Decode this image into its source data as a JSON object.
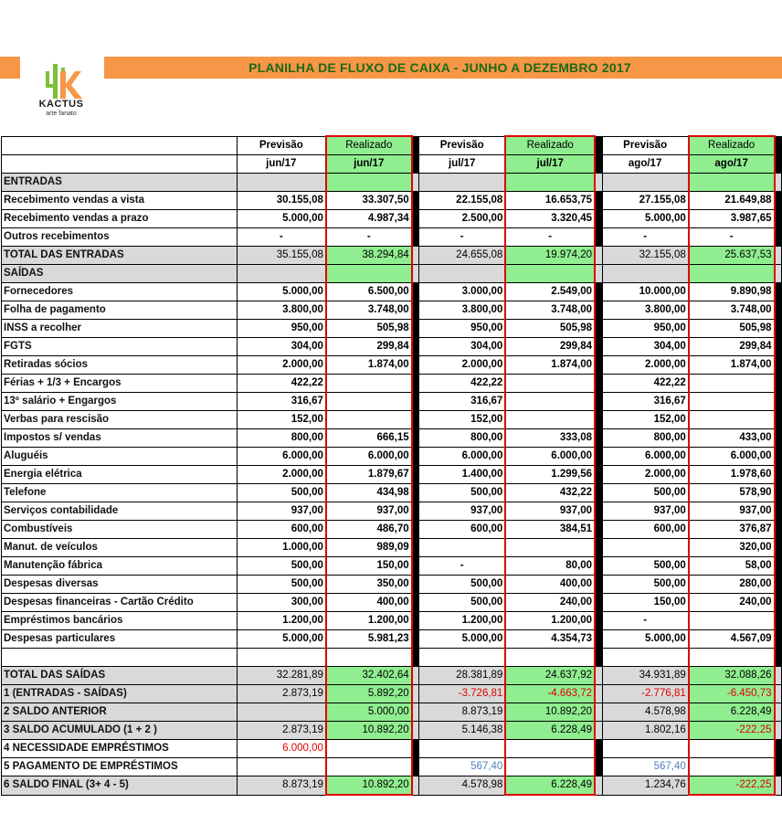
{
  "title": "PLANILHA DE FLUXO DE CAIXA - JUNHO A DEZEMBRO 2017",
  "logo": {
    "name": "KACTUS",
    "sub": "arte fanato"
  },
  "headers": {
    "row1": [
      "Previsão",
      "Realizado",
      "Previsão",
      "Realizado",
      "Previsão",
      "Realizado"
    ],
    "row2": [
      "jun/17",
      "jun/17",
      "jul/17",
      "jul/17",
      "ago/17",
      "ago/17"
    ]
  },
  "rows": [
    {
      "label": "ENTRADAS",
      "type": "section",
      "values": [
        "",
        "",
        "",
        "",
        "",
        ""
      ]
    },
    {
      "label": "Recebimento vendas a vista",
      "values": [
        "30.155,08",
        "33.307,50",
        "22.155,08",
        "16.653,75",
        "27.155,08",
        "21.649,88"
      ]
    },
    {
      "label": "Recebimento vendas a prazo",
      "values": [
        "5.000,00",
        "4.987,34",
        "2.500,00",
        "3.320,45",
        "5.000,00",
        "3.987,65"
      ]
    },
    {
      "label": "Outros recebimentos",
      "values": [
        "-",
        "-",
        "-",
        "-",
        "-",
        "-"
      ]
    },
    {
      "label": "TOTAL DAS ENTRADAS",
      "type": "total",
      "values": [
        "35.155,08",
        "38.294,84",
        "24.655,08",
        "19.974,20",
        "32.155,08",
        "25.637,53"
      ]
    },
    {
      "label": "SAÍDAS",
      "type": "section",
      "values": [
        "",
        "",
        "",
        "",
        "",
        ""
      ]
    },
    {
      "label": "Fornecedores",
      "values": [
        "5.000,00",
        "6.500,00",
        "3.000,00",
        "2.549,00",
        "10.000,00",
        "9.890,98"
      ]
    },
    {
      "label": "Folha de pagamento",
      "values": [
        "3.800,00",
        "3.748,00",
        "3.800,00",
        "3.748,00",
        "3.800,00",
        "3.748,00"
      ]
    },
    {
      "label": "INSS a recolher",
      "values": [
        "950,00",
        "505,98",
        "950,00",
        "505,98",
        "950,00",
        "505,98"
      ]
    },
    {
      "label": "FGTS",
      "values": [
        "304,00",
        "299,84",
        "304,00",
        "299,84",
        "304,00",
        "299,84"
      ]
    },
    {
      "label": "Retiradas sócios",
      "values": [
        "2.000,00",
        "1.874,00",
        "2.000,00",
        "1.874,00",
        "2.000,00",
        "1.874,00"
      ]
    },
    {
      "label": "Férias + 1/3 + Encargos",
      "values": [
        "422,22",
        "",
        "422,22",
        "",
        "422,22",
        ""
      ]
    },
    {
      "label": "13º salário + Engargos",
      "values": [
        "316,67",
        "",
        "316,67",
        "",
        "316,67",
        ""
      ]
    },
    {
      "label": "Verbas para rescisão",
      "values": [
        "152,00",
        "",
        "152,00",
        "",
        "152,00",
        ""
      ]
    },
    {
      "label": "Impostos s/ vendas",
      "values": [
        "800,00",
        "666,15",
        "800,00",
        "333,08",
        "800,00",
        "433,00"
      ]
    },
    {
      "label": "Aluguéis",
      "values": [
        "6.000,00",
        "6.000,00",
        "6.000,00",
        "6.000,00",
        "6.000,00",
        "6.000,00"
      ]
    },
    {
      "label": "Energia elétrica",
      "values": [
        "2.000,00",
        "1.879,67",
        "1.400,00",
        "1.299,56",
        "2.000,00",
        "1.978,60"
      ]
    },
    {
      "label": "Telefone",
      "values": [
        "500,00",
        "434,98",
        "500,00",
        "432,22",
        "500,00",
        "578,90"
      ]
    },
    {
      "label": "Serviços contabilidade",
      "values": [
        "937,00",
        "937,00",
        "937,00",
        "937,00",
        "937,00",
        "937,00"
      ]
    },
    {
      "label": "Combustíveis",
      "values": [
        "600,00",
        "486,70",
        "600,00",
        "384,51",
        "600,00",
        "376,87"
      ]
    },
    {
      "label": "Manut. de veículos",
      "values": [
        "1.000,00",
        "989,09",
        "",
        "",
        "",
        "320,00"
      ]
    },
    {
      "label": "Manutenção fábrica",
      "values": [
        "500,00",
        "150,00",
        "-",
        "80,00",
        "500,00",
        "58,00"
      ]
    },
    {
      "label": "Despesas diversas",
      "values": [
        "500,00",
        "350,00",
        "500,00",
        "400,00",
        "500,00",
        "280,00"
      ]
    },
    {
      "label": "Despesas financeiras - Cartão Crédito",
      "values": [
        "300,00",
        "400,00",
        "500,00",
        "240,00",
        "150,00",
        "240,00"
      ]
    },
    {
      "label": "Empréstimos bancários",
      "values": [
        "1.200,00",
        "1.200,00",
        "1.200,00",
        "1.200,00",
        "-",
        ""
      ]
    },
    {
      "label": "Despesas particulares",
      "values": [
        "5.000,00",
        "5.981,23",
        "5.000,00",
        "4.354,73",
        "5.000,00",
        "4.567,09"
      ]
    },
    {
      "label": "",
      "type": "blank",
      "values": [
        "",
        "",
        "",
        "",
        "",
        ""
      ]
    },
    {
      "label": "TOTAL DAS SAÍDAS",
      "type": "total",
      "values": [
        "32.281,89",
        "32.402,64",
        "28.381,89",
        "24.637,92",
        "34.931,89",
        "32.088,26"
      ]
    },
    {
      "label": "1 (ENTRADAS - SAÍDAS)",
      "type": "total",
      "values": [
        "2.873,19",
        "5.892,20",
        "-3.726,81",
        "-4.663,72",
        "-2.776,81",
        "-6.450,73"
      ]
    },
    {
      "label": "2 SALDO ANTERIOR",
      "type": "total",
      "values": [
        "",
        "5.000,00",
        "8.873,19",
        "10.892,20",
        "4.578,98",
        "6.228,49"
      ]
    },
    {
      "label": "3 SALDO ACUMULADO (1 + 2 )",
      "type": "total",
      "values": [
        "2.873,19",
        "10.892,20",
        "5.146,38",
        "6.228,49",
        "1.802,16",
        "-222,25"
      ]
    },
    {
      "label": "4 NECESSIDADE EMPRÉSTIMOS",
      "type": "red",
      "values": [
        "6.000,00",
        "",
        "",
        "",
        "",
        ""
      ]
    },
    {
      "label": "5 PAGAMENTO DE EMPRÉSTIMOS",
      "type": "blue",
      "values": [
        "",
        "",
        "567,40",
        "",
        "567,40",
        ""
      ]
    },
    {
      "label": "6 SALDO FINAL (3+ 4 - 5)",
      "type": "total",
      "values": [
        "8.873,19",
        "10.892,20",
        "4.578,98",
        "6.228,49",
        "1.234,76",
        "-222,25"
      ]
    }
  ],
  "colors": {
    "orange": "#f79646",
    "title_green": "#1c6a18",
    "real_green": "#90ee90",
    "gray": "#d9d9d9",
    "red": "#e00000",
    "blue": "#4f81bd"
  }
}
